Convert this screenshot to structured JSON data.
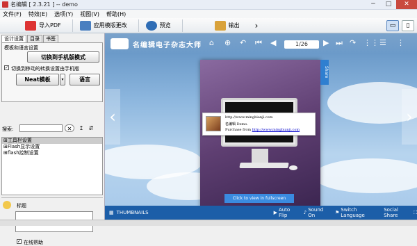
{
  "window": {
    "title": "名编辑 [ 2.3.21 ] -- demo",
    "min": "─",
    "max": "□",
    "close": "✕"
  },
  "menu": [
    "文件(F)",
    "特效(E)",
    "选项(Y)",
    "视图(V)",
    "帮助(H)"
  ],
  "toolbar": {
    "import_pdf": "导入PDF",
    "apply": "应用模版更改",
    "preview": "预览",
    "output": "输出",
    "more": "›",
    "pc": "▭",
    "mobile": "▯"
  },
  "left": {
    "tabs": [
      "设计设置",
      "目录",
      "书签"
    ],
    "template_lang": "模板和语言设置",
    "switch_mobile": "切换到手机版模式",
    "checkbox_label": "切换到移动的转换设置由手机版",
    "neat_template": "Neat模板",
    "language": "语言",
    "password_label": "搜索:",
    "tree": [
      "工具栏设置",
      "Flash显示设置",
      "flash控制设置"
    ],
    "note_label": "标题",
    "bottom_check": "在线帮助"
  },
  "viewer": {
    "brand": "名编辑电子杂志大师",
    "page_indicator": "1/26",
    "popup": {
      "line1": "http://www.mingbianji.com",
      "line2": "名编辑 Demo.",
      "line3": "Purchase from",
      "link": "http://www.mingbianji.com"
    },
    "fullscreen": "Click to view in fullscreen",
    "side_tab": "Share",
    "thumbnails": "THUMBNAILS",
    "auto_flip": "Auto Flip",
    "sound": "Sound On",
    "switch_lang": "Switch Language",
    "social": "Social Share"
  }
}
